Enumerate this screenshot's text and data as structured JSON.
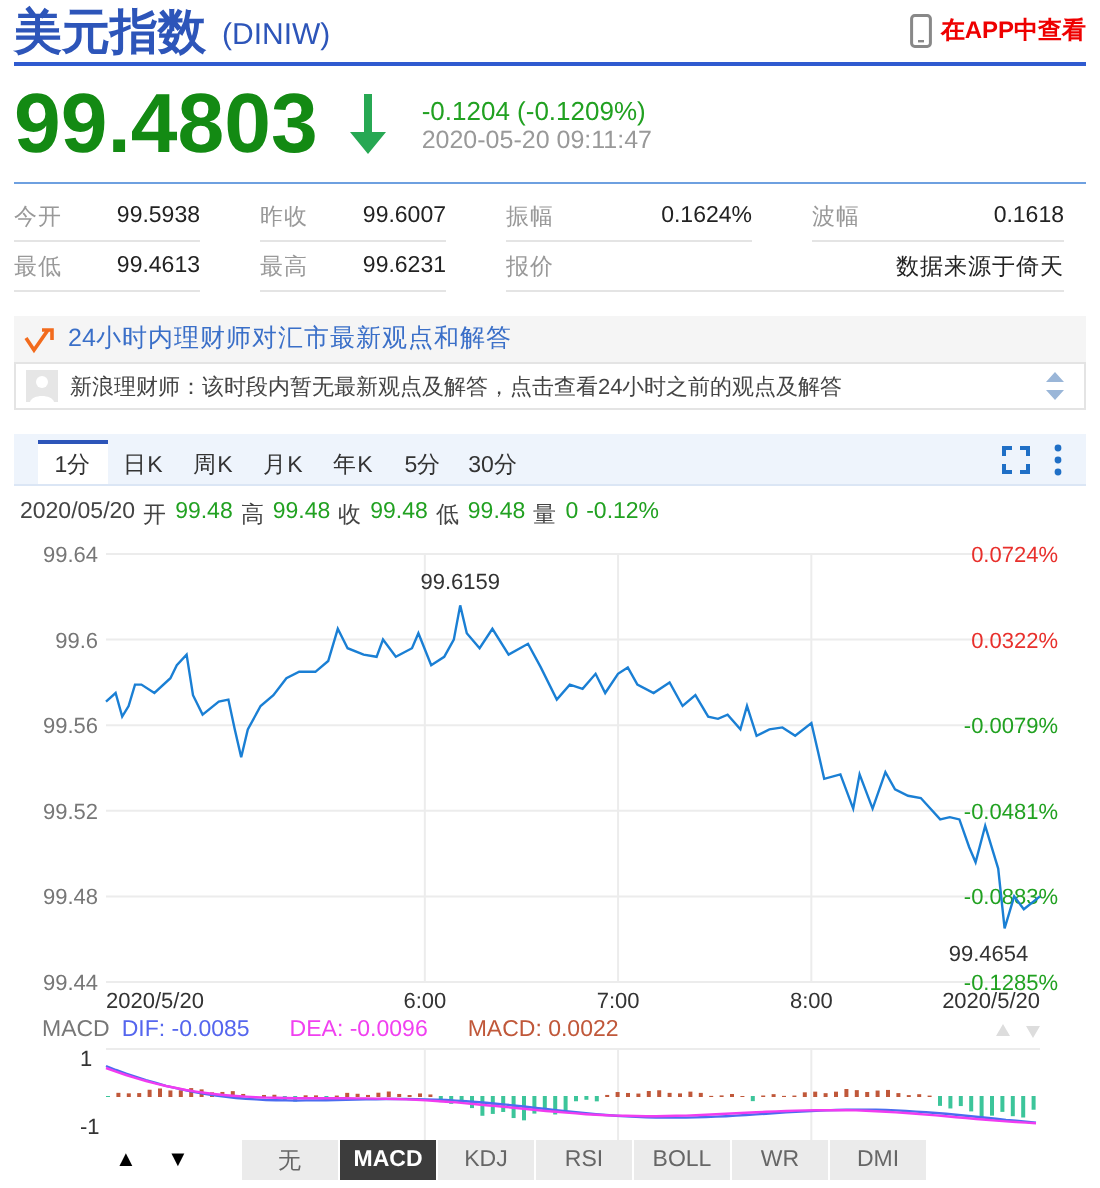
{
  "header": {
    "title": "美元指数",
    "code": "(DINIW)",
    "app_link": "在APP中查看"
  },
  "quote": {
    "price": "99.4803",
    "change": "-0.1204 (-0.1209%)",
    "time": "2020-05-20 09:11:47"
  },
  "stats": [
    [
      {
        "label": "今开",
        "value": "99.5938"
      },
      {
        "label": "昨收",
        "value": "99.6007"
      },
      {
        "label": "振幅",
        "value": "0.1624%"
      },
      {
        "label": "波幅",
        "value": "0.1618"
      }
    ],
    [
      {
        "label": "最低",
        "value": "99.4613"
      },
      {
        "label": "最高",
        "value": "99.6231"
      },
      {
        "label": "报价",
        "value": "数据来源于倚天"
      }
    ]
  ],
  "advisor": {
    "heading": "24小时内理财师对汇市最新观点和解答",
    "message": "新浪理财师：该时段内暂无最新观点及解答，点击查看24小时之前的观点及解答"
  },
  "period_tabs": [
    {
      "label": "1分",
      "selected": true
    },
    {
      "label": "日K",
      "selected": false
    },
    {
      "label": "周K",
      "selected": false
    },
    {
      "label": "月K",
      "selected": false
    },
    {
      "label": "年K",
      "selected": false
    },
    {
      "label": "5分",
      "selected": false
    },
    {
      "label": "30分",
      "selected": false
    }
  ],
  "ohlc": [
    {
      "label": "2020/05/20"
    },
    {
      "label": "开",
      "value": "99.48"
    },
    {
      "label": "高",
      "value": "99.48"
    },
    {
      "label": "收",
      "value": "99.48"
    },
    {
      "label": "低",
      "value": "99.48"
    },
    {
      "label": "量",
      "value": "0"
    },
    {
      "value": "-0.12%"
    }
  ],
  "chart": {
    "chart_data": {
      "type": "line",
      "x": [
        261,
        264,
        266,
        268,
        270,
        272,
        276,
        281,
        283,
        286,
        288,
        291,
        296,
        299,
        301,
        303,
        305,
        309,
        313,
        317,
        321,
        326,
        330,
        333,
        336,
        341,
        345,
        347,
        351,
        356,
        358,
        362,
        366,
        369,
        371,
        373,
        377,
        381,
        386,
        392,
        396,
        401,
        405,
        409,
        413,
        416,
        420,
        423,
        426,
        431,
        436,
        440,
        444,
        448,
        451,
        454,
        458,
        460,
        463,
        467,
        471,
        475,
        480,
        482,
        484,
        489,
        493,
        495,
        499,
        503,
        506,
        510,
        514,
        520,
        523,
        526,
        529,
        531,
        534,
        538,
        540,
        543,
        546,
        551
      ],
      "series": [
        {
          "color": "#1a7fd4",
          "values": [
            99.571,
            99.575,
            99.564,
            99.569,
            99.579,
            99.579,
            99.575,
            99.582,
            99.588,
            99.593,
            99.574,
            99.565,
            99.571,
            99.572,
            99.558,
            99.545,
            99.558,
            99.569,
            99.574,
            99.582,
            99.585,
            99.585,
            99.59,
            99.605,
            99.596,
            99.593,
            99.592,
            99.6,
            99.592,
            99.596,
            99.603,
            99.588,
            99.592,
            99.6,
            99.616,
            99.603,
            99.596,
            99.605,
            99.593,
            99.598,
            99.587,
            99.572,
            99.579,
            99.577,
            99.584,
            99.575,
            99.584,
            99.587,
            99.579,
            99.575,
            99.58,
            99.569,
            99.574,
            99.564,
            99.563,
            99.565,
            99.558,
            99.569,
            99.555,
            99.558,
            99.559,
            99.555,
            99.561,
            99.548,
            99.535,
            99.537,
            99.521,
            99.537,
            99.521,
            99.538,
            99.53,
            99.527,
            99.526,
            99.516,
            99.517,
            99.516,
            99.503,
            99.496,
            99.513,
            99.493,
            99.465,
            99.48,
            99.474,
            99.48
          ]
        }
      ],
      "grid": true,
      "xlim": [
        261,
        551
      ],
      "ylim": [
        99.44,
        99.64
      ],
      "yticks": [
        99.44,
        99.48,
        99.52,
        99.56,
        99.6,
        99.64
      ],
      "xticks": [
        {
          "value": 261,
          "label": "2020/5/20"
        },
        {
          "value": 360,
          "label": "6:00"
        },
        {
          "value": 420,
          "label": "7:00"
        },
        {
          "value": 480,
          "label": "8:00"
        },
        {
          "value": 551,
          "label": "2020/5/20"
        }
      ],
      "annotations": [
        {
          "x": 371,
          "y": 99.616,
          "text": "99.6159"
        },
        {
          "x": 540,
          "y": 99.465,
          "text": "99.4654"
        }
      ]
    },
    "percent_labels": [
      {
        "text": "0.0724%",
        "color": "#e8302c"
      },
      {
        "text": "0.0322%",
        "color": "#e8302c"
      },
      {
        "text": "-0.0079%",
        "color": "#21a121"
      },
      {
        "text": "-0.0481%",
        "color": "#21a121"
      },
      {
        "text": "-0.0883%",
        "color": "#21a121"
      },
      {
        "text": "-0.1285%",
        "color": "#21a121"
      }
    ]
  },
  "macd": {
    "name": "MACD",
    "dif": "DIF: -0.0085",
    "dea": "DEA: -0.0096",
    "macd": "MACD: 0.0022",
    "ticks": [
      "1",
      "-1"
    ]
  },
  "nav_buttons": [
    "▲",
    "▼"
  ],
  "indicator_tabs": [
    {
      "label": "无",
      "selected": false
    },
    {
      "label": "MACD",
      "selected": true
    },
    {
      "label": "KDJ",
      "selected": false
    },
    {
      "label": "RSI",
      "selected": false
    },
    {
      "label": "BOLL",
      "selected": false
    },
    {
      "label": "WR",
      "selected": false
    },
    {
      "label": "DMI",
      "selected": false
    }
  ]
}
